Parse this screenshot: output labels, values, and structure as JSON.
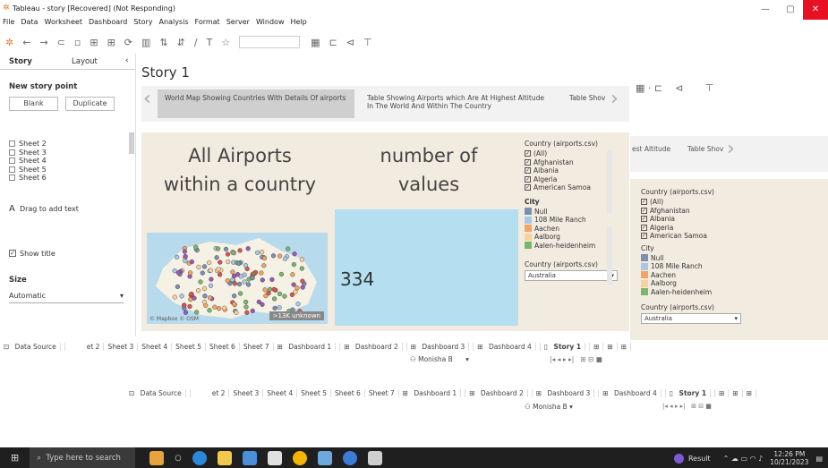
{
  "window": {
    "title": "Tableau - story [Recovered] (Not Responding)"
  },
  "menu": [
    "File",
    "Data",
    "Worksheet",
    "Dashboard",
    "Story",
    "Analysis",
    "Format",
    "Server",
    "Window",
    "Help"
  ],
  "sidebar": {
    "tabs": [
      "Story",
      "Layout"
    ],
    "new_story_point": "New story point",
    "blank_label": "Blank",
    "duplicate_label": "Duplicate",
    "sheets": [
      "Sheet 2",
      "Sheet 3",
      "Sheet 4",
      "Sheet 5",
      "Sheet 6"
    ],
    "drag_text": "Drag to add text",
    "show_title": "Show title",
    "size_label": "Size",
    "size_value": "Automatic"
  },
  "story": {
    "title": "Story 1",
    "points": [
      "World Map Showing Countries With Details Of airports",
      "Table Showing Airports which Are At Highest Altitude In The World And Within The Country",
      "Table Shov"
    ]
  },
  "dashboard": {
    "heading_left": "All Airports within a country",
    "heading_right": "number of values",
    "value": "334",
    "unknown_badge": ">13K unknown",
    "map_attribution": "© Mapbox © OSM"
  },
  "filters": {
    "country_title": "Country (airports.csv)",
    "countries": [
      "(All)",
      "Afghanistan",
      "Albania",
      "Algeria",
      "American Samoa"
    ],
    "city_title": "City",
    "cities": [
      {
        "name": "Null",
        "color": "#7b8fb5"
      },
      {
        "name": "108 Mile Ranch",
        "color": "#a7c8e8"
      },
      {
        "name": "Aachen",
        "color": "#f4a460"
      },
      {
        "name": "Aalborg",
        "color": "#fbd19a"
      },
      {
        "name": "Aalen-heidenheim",
        "color": "#78b86a"
      }
    ],
    "country_select_title": "Country (airports.csv)",
    "country_selected": "Australia"
  },
  "back_window": {
    "point": "Table Shov",
    "partial_point": "est Altitude"
  },
  "tabs": {
    "data_source": "Data Source",
    "items": [
      "et 2",
      "Sheet 3",
      "Sheet 4",
      "Sheet 5",
      "Sheet 6",
      "Sheet 7",
      "Dashboard 1",
      "Dashboard 2",
      "Dashboard 3",
      "Dashboard 4",
      "Story 1"
    ],
    "back_items": [
      "et 2",
      "Sheet 3",
      "Sheet 4",
      "Sheet 5",
      "Sheet 6",
      "Sheet 7",
      "Dashboard 1",
      "Dashboard 2",
      "Dashboard 3",
      "Dashboard 4",
      "Story 1"
    ],
    "user": "Monisha B"
  },
  "taskbar": {
    "search_placeholder": "Type here to search",
    "result_label": "Result",
    "time": "12:26 PM",
    "date": "10/21/2023"
  }
}
